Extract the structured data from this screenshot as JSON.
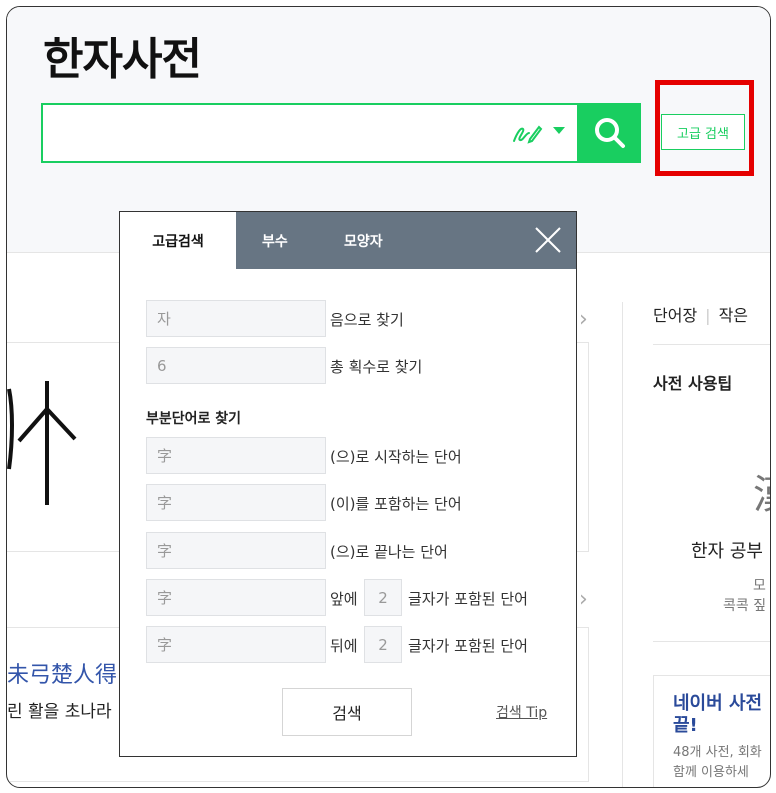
{
  "header": {
    "title": "한자사전",
    "search_placeholder": "",
    "advanced_button": "고급 검색"
  },
  "colors": {
    "accent": "#19ce60",
    "highlight": "#e50000",
    "tabbar": "#677583"
  },
  "modal": {
    "tabs": [
      "고급검색",
      "부수",
      "모양자"
    ],
    "fields": {
      "reading_placeholder": "자",
      "reading_label": "음으로 찾기",
      "strokes_placeholder": "6",
      "strokes_label": "총 획수로 찾기",
      "section_title": "부분단어로 찾기",
      "starts_placeholder": "字",
      "starts_label": "(으)로 시작하는 단어",
      "contains_placeholder": "字",
      "contains_label": "(이)를 포함하는 단어",
      "ends_placeholder": "字",
      "ends_label": "(으)로 끝나는 단어",
      "front_placeholder": "字",
      "front_prefix": "앞에",
      "front_count": "2",
      "front_suffix": "글자가 포함된 단어",
      "back_placeholder": "字",
      "back_prefix": "뒤에",
      "back_count": "2",
      "back_suffix": "글자가 포함된 단어"
    },
    "search_button": "검색",
    "tip_link": "검색 Tip"
  },
  "background": {
    "hanja_line": "未弓楚人得",
    "korean_line": "린 활을 초나라",
    "right_links": [
      "단어장",
      "작은"
    ],
    "tips_title": "사전 사용팁",
    "big_glyph": "漢",
    "study_text": "한자 공부",
    "sub1": "모",
    "sub2": "콕콕 짚",
    "card_title": "네이버 사전 끝!",
    "card_desc_1": "48개 사전, 회화",
    "card_desc_2": "함께 이용하세"
  }
}
